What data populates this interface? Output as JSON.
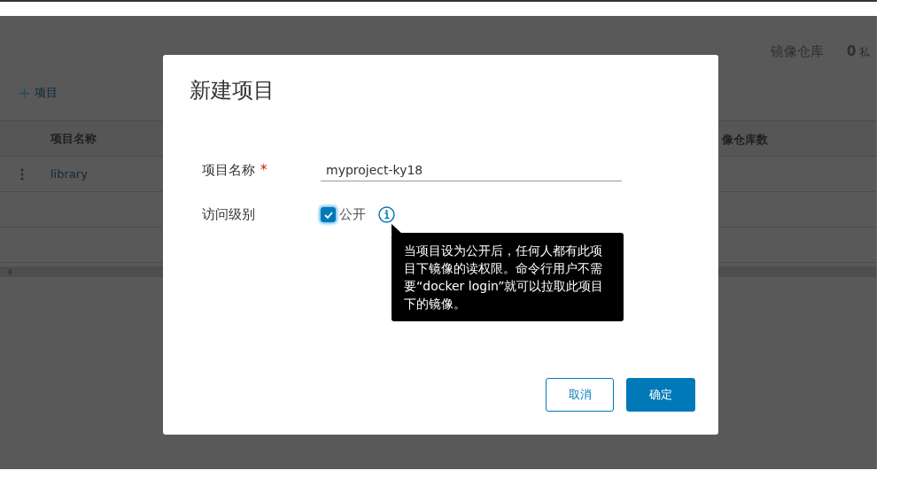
{
  "background": {
    "stats": [
      {
        "label": "镜像仓库",
        "value": "0",
        "suffix": "私"
      }
    ],
    "add_button": {
      "label": "项目"
    },
    "table": {
      "columns": [
        "项目名称",
        "像仓库数"
      ],
      "rows": [
        {
          "name": "library"
        }
      ]
    }
  },
  "dialog": {
    "title": "新建项目",
    "fields": [
      {
        "kind": "text",
        "label": "项目名称",
        "required_mark": "*",
        "value": "myproject-ky18"
      },
      {
        "kind": "checkbox",
        "label": "访问级别",
        "option": "公开",
        "checked": true,
        "tooltip": "当项目设为公开后，任何人都有此项目下镜像的读权限。命令行用户不需要“docker login”就可以拉取此项目下的镜像。"
      }
    ],
    "buttons": [
      {
        "kind": "outline",
        "label": "取消"
      },
      {
        "kind": "primary",
        "label": "确定"
      }
    ]
  }
}
